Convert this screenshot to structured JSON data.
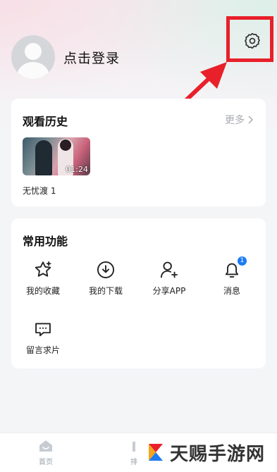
{
  "profile": {
    "login_label": "点击登录"
  },
  "history": {
    "title": "观看历史",
    "more_label": "更多",
    "items": [
      {
        "title": "无忧渡 1",
        "duration": "01:24"
      }
    ]
  },
  "functions": {
    "title": "常用功能",
    "items": [
      {
        "label": "我的收藏",
        "icon": "star-icon"
      },
      {
        "label": "我的下载",
        "icon": "download-icon"
      },
      {
        "label": "分享APP",
        "icon": "add-user-icon"
      },
      {
        "label": "消息",
        "icon": "bell-icon",
        "badge": "1"
      },
      {
        "label": "留言求片",
        "icon": "message-icon"
      }
    ]
  },
  "tabbar": {
    "items": [
      {
        "label": "首页",
        "icon": "home-icon"
      },
      {
        "label": "排",
        "icon": "rank-icon"
      }
    ]
  },
  "watermark": {
    "text": "天赐手游网"
  },
  "colors": {
    "highlight": "#e8202a",
    "badge": "#1d7cf2",
    "background": "#f4f5f7"
  }
}
